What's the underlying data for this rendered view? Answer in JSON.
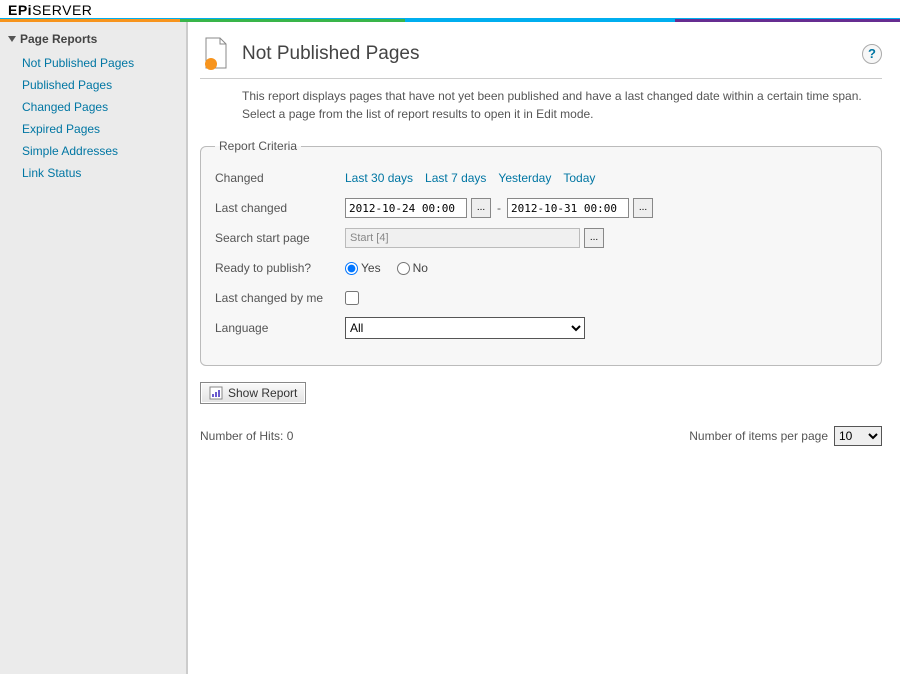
{
  "brand": {
    "pre": "EPi",
    "post": "SERVER"
  },
  "sidebar": {
    "header": "Page Reports",
    "items": [
      {
        "label": "Not Published Pages"
      },
      {
        "label": "Published Pages"
      },
      {
        "label": "Changed Pages"
      },
      {
        "label": "Expired Pages"
      },
      {
        "label": "Simple Addresses"
      },
      {
        "label": "Link Status"
      }
    ]
  },
  "page": {
    "title": "Not Published Pages",
    "help_tooltip": "?",
    "description": "This report displays pages that have not yet been published and have a last changed date within a certain time span. Select a page from the list of report results to open it in Edit mode."
  },
  "criteria": {
    "legend": "Report Criteria",
    "changed_label": "Changed",
    "changed_links": [
      "Last 30 days",
      "Last 7 days",
      "Yesterday",
      "Today"
    ],
    "last_changed_label": "Last changed",
    "date_from": "2012-10-24 00:00",
    "date_to": "2012-10-31 00:00",
    "picker_btn": "...",
    "date_sep": "-",
    "search_start_label": "Search start page",
    "search_start_value": "Start [4]",
    "ready_label": "Ready to publish?",
    "yes": "Yes",
    "no": "No",
    "by_me_label": "Last changed by me",
    "language_label": "Language",
    "language_value": "All"
  },
  "actions": {
    "show_report": "Show Report"
  },
  "results": {
    "hits_label": "Number of Hits: 0",
    "per_page_label": "Number of items per page",
    "per_page_value": "10"
  }
}
